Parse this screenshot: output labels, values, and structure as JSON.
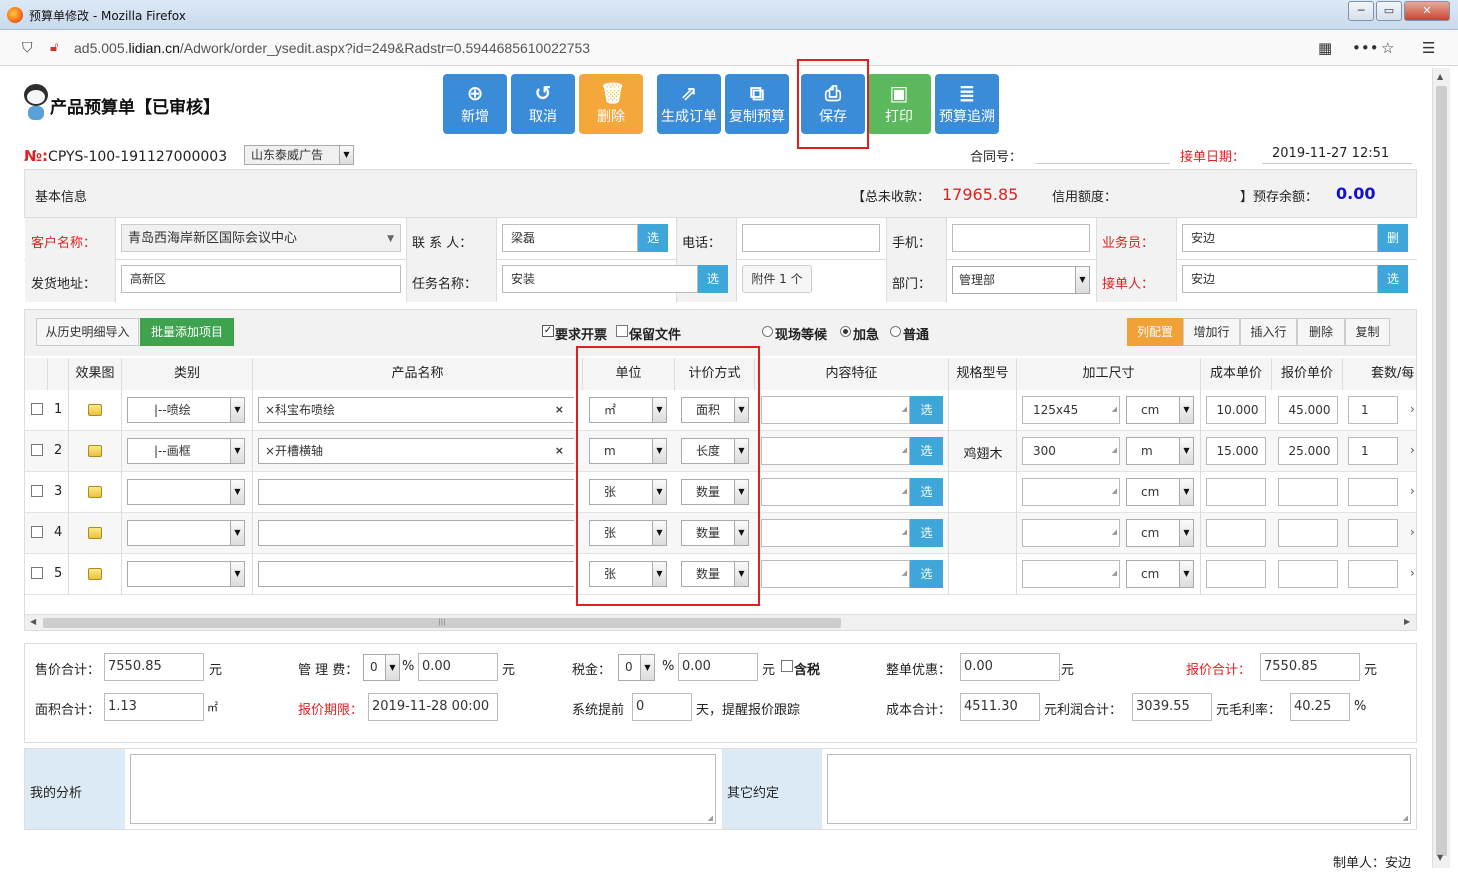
{
  "window": {
    "title": "预算单修改 - Mozilla Firefox"
  },
  "browser": {
    "url_prefix": "ad5.005.",
    "url_domain": "lidian.cn",
    "url_rest": "/Adwork/order_ysedit.aspx?id=249&Radstr=0.5944685610022753"
  },
  "page": {
    "title": "产品预算单【已审核】"
  },
  "toolbar": {
    "add": "新增",
    "cancel": "取消",
    "delete": "删除",
    "gen_order": "生成订单",
    "copy_budget": "复制预算",
    "save": "保存",
    "print": "打印",
    "trace": "预算追溯"
  },
  "header": {
    "no_label": "№:",
    "no_value": "CPYS-100-191127000003",
    "company": "山东泰威广告",
    "contract_label": "合同号：",
    "contract_value": "",
    "date_label": "接单日期：",
    "date_value": "2019-11-27 12:51"
  },
  "info": {
    "section": "基本信息",
    "unpaid_label": "【总未收款：",
    "unpaid_value": "17965.85",
    "credit_label": "信用额度：",
    "credit_value": "",
    "balance_label": "】预存余额：",
    "balance_value": "0.00",
    "customer_label": "客户名称：",
    "customer_value": "青岛西海岸新区国际会议中心",
    "contact_label": "联 系 人：",
    "contact_value": "梁磊",
    "select": "选",
    "phone_label": "电话：",
    "phone_value": "",
    "mobile_label": "手机：",
    "mobile_value": "",
    "salesman_label": "业务员：",
    "salesman_value": "安边",
    "del": "删",
    "address_label": "发货地址：",
    "address_value": "高新区",
    "task_label": "任务名称：",
    "task_value": "安装",
    "attach": "附件 1 个",
    "dept_label": "部门：",
    "dept_value": "管理部",
    "receiver_label": "接单人：",
    "receiver_value": "安边"
  },
  "items_toolbar": {
    "import_history": "从历史明细导入",
    "batch_add": "批量添加项目",
    "need_invoice": "要求开票",
    "keep_file": "保留文件",
    "onsite": "现场等候",
    "urgent": "加急",
    "normal": "普通",
    "col_config": "列配置",
    "add_row": "增加行",
    "insert_row": "插入行",
    "delete": "删除",
    "copy": "复制"
  },
  "table": {
    "headers": [
      "效果图",
      "类别",
      "产品名称",
      "单位",
      "计价方式",
      "内容特征",
      "规格型号",
      "加工尺寸",
      "成本单价",
      "报价单价",
      "套数/每"
    ],
    "rows": [
      {
        "no": "1",
        "category": "|--喷绘",
        "product": "×科宝布喷绘",
        "unit": "㎡",
        "pricing": "面积",
        "spec": "",
        "size": "125x45",
        "size_unit": "cm",
        "cost": "10.000",
        "price": "45.000",
        "qty": "1"
      },
      {
        "no": "2",
        "category": "|--画框",
        "product": "×开槽横轴",
        "unit": "m",
        "pricing": "长度",
        "spec": "鸡翅木",
        "size": "300",
        "size_unit": "m",
        "cost": "15.000",
        "price": "25.000",
        "qty": "1"
      },
      {
        "no": "3",
        "category": "",
        "product": "",
        "unit": "张",
        "pricing": "数量",
        "spec": "",
        "size": "",
        "size_unit": "cm",
        "cost": "",
        "price": "",
        "qty": ""
      },
      {
        "no": "4",
        "category": "",
        "product": "",
        "unit": "张",
        "pricing": "数量",
        "spec": "",
        "size": "",
        "size_unit": "cm",
        "cost": "",
        "price": "",
        "qty": ""
      },
      {
        "no": "5",
        "category": "",
        "product": "",
        "unit": "张",
        "pricing": "数量",
        "spec": "",
        "size": "",
        "size_unit": "cm",
        "cost": "",
        "price": "",
        "qty": ""
      }
    ],
    "select": "选",
    "clear": "×"
  },
  "summary": {
    "sale_total_label": "售价合计：",
    "sale_total": "7550.85",
    "yuan": "元",
    "mgmt_label": "管 理 费：",
    "mgmt_pct": "0",
    "pct": "%",
    "mgmt_value": "0.00",
    "tax_label": "税金：",
    "tax_pct": "0",
    "tax_value": "0.00",
    "tax_incl": "含税",
    "discount_label": "整单优惠：",
    "discount_value": "0.00",
    "quote_total_label": "报价合计：",
    "quote_total": "7550.85",
    "area_label": "面积合计：",
    "area_value": "1.13",
    "area_unit": "㎡",
    "quote_deadline_label": "报价期限：",
    "quote_deadline": "2019-11-28 00:00",
    "remind_label": "系统提前",
    "remind_value": "0",
    "remind_suffix": "天，提醒报价跟踪",
    "cost_total_label": "成本合计：",
    "cost_total": "4511.30",
    "profit_label": "元利润合计：",
    "profit_value": "3039.55",
    "margin_label": "元毛利率：",
    "margin_value": "40.25",
    "margin_pct": "%"
  },
  "notes": {
    "analysis_label": "我的分析",
    "other_label": "其它约定"
  },
  "footer": {
    "maker": "制单人：安边"
  }
}
